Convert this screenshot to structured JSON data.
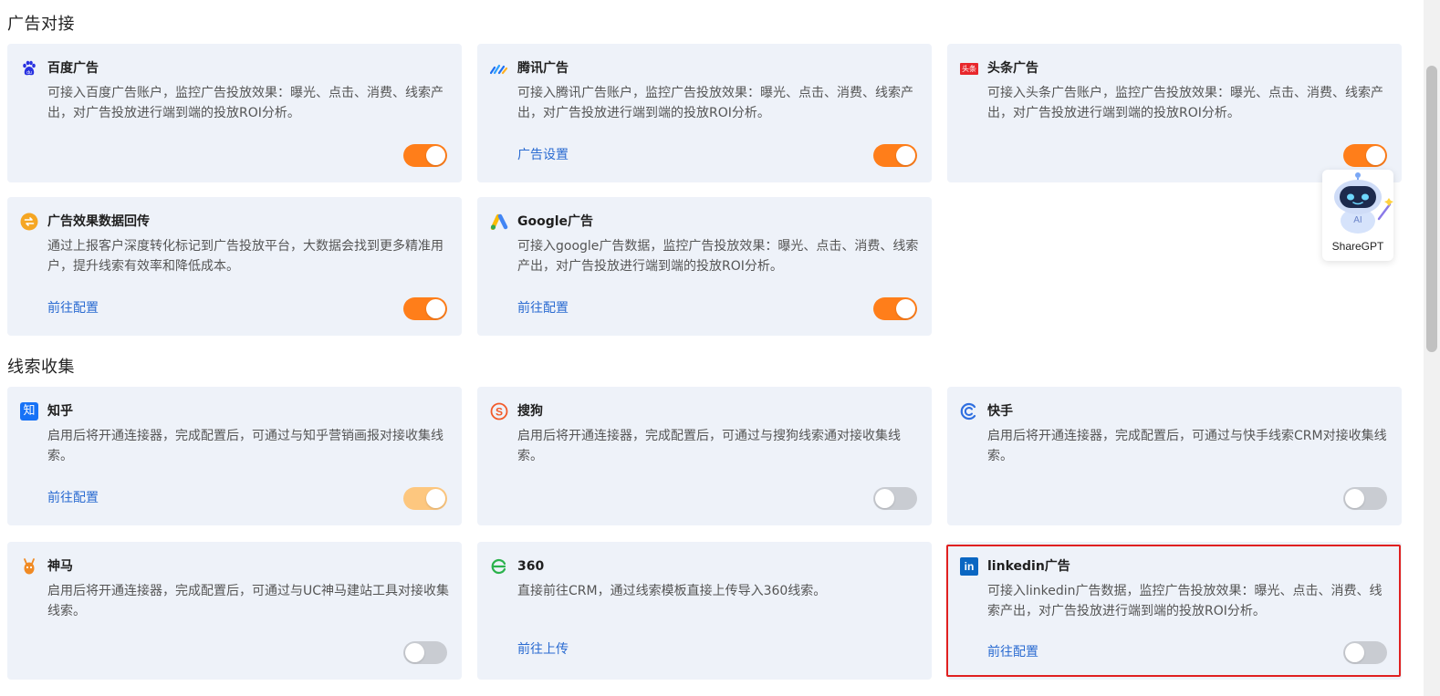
{
  "sections": {
    "ads_title": "广告对接",
    "leads_title": "线索收集"
  },
  "cards": [
    {
      "name": "百度广告",
      "desc": "可接入百度广告账户，监控广告投放效果：曝光、点击、消费、线索产出，对广告投放进行端到端的投放ROI分析。",
      "link": "",
      "toggle": "on",
      "icon": "baidu-icon"
    },
    {
      "name": "腾讯广告",
      "desc": "可接入腾讯广告账户，监控广告投放效果：曝光、点击、消费、线索产出，对广告投放进行端到端的投放ROI分析。",
      "link": "广告设置",
      "toggle": "on",
      "icon": "tencent-ads-icon"
    },
    {
      "name": "头条广告",
      "desc": "可接入头条广告账户，监控广告投放效果：曝光、点击、消费、线索产出，对广告投放进行端到端的投放ROI分析。",
      "link": "",
      "toggle": "on",
      "icon": "toutiao-icon",
      "icon_text": "头条"
    },
    {
      "name": "广告效果数据回传",
      "desc": "通过上报客户深度转化标记到广告投放平台，大数据会找到更多精准用户，提升线索有效率和降低成本。",
      "link": "前往配置",
      "toggle": "on",
      "icon": "data-return-icon"
    },
    {
      "name": "Google广告",
      "desc": "可接入google广告数据，监控广告投放效果：曝光、点击、消费、线索产出，对广告投放进行端到端的投放ROI分析。",
      "link": "前往配置",
      "toggle": "on",
      "icon": "google-ads-icon"
    },
    {
      "name": "知乎",
      "desc": "启用后将开通连接器，完成配置后，可通过与知乎营销画报对接收集线索。",
      "link": "前往配置",
      "toggle": "on-disabled",
      "icon": "zhihu-icon",
      "icon_text": "知"
    },
    {
      "name": "搜狗",
      "desc": "启用后将开通连接器，完成配置后，可通过与搜狗线索通对接收集线索。",
      "link": "",
      "toggle": "off",
      "icon": "sogou-icon"
    },
    {
      "name": "快手",
      "desc": "启用后将开通连接器，完成配置后，可通过与快手线索CRM对接收集线索。",
      "link": "",
      "toggle": "off",
      "icon": "kuaishou-icon"
    },
    {
      "name": "神马",
      "desc": "启用后将开通连接器，完成配置后，可通过与UC神马建站工具对接收集线索。",
      "link": "",
      "toggle": "off",
      "icon": "shenma-icon"
    },
    {
      "name": "360",
      "desc": "直接前往CRM，通过线索模板直接上传导入360线索。",
      "link": "前往上传",
      "toggle": "none",
      "icon": "360-icon"
    },
    {
      "name": "linkedin广告",
      "desc": "可接入linkedin广告数据，监控广告投放效果：曝光、点击、消费、线索产出，对广告投放进行端到端的投放ROI分析。",
      "link": "前往配置",
      "toggle": "off",
      "icon": "linkedin-icon",
      "icon_text": "in"
    }
  ],
  "assistant": {
    "label": "ShareGPT",
    "badge": "AI"
  },
  "colors": {
    "accent": "#ff7e1a",
    "link": "#2a6bd1",
    "card_bg": "#eef2f9",
    "highlight": "#e02020"
  }
}
